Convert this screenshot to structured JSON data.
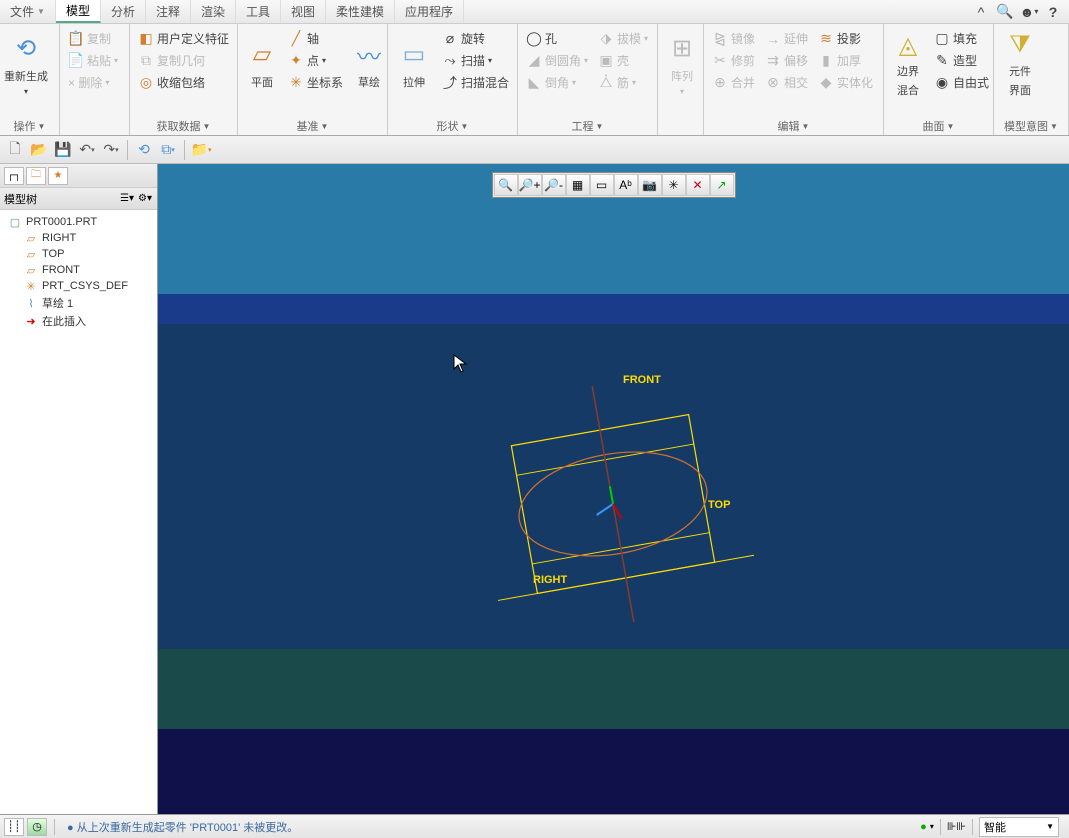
{
  "menu": {
    "file": "文件",
    "model": "模型",
    "analysis": "分析",
    "annotate": "注释",
    "render": "渲染",
    "tools": "工具",
    "view": "视图",
    "flex": "柔性建模",
    "app": "应用程序"
  },
  "ribbon": {
    "ops": {
      "label": "操作",
      "regen": "重新生成",
      "copy": "复制",
      "paste": "粘贴",
      "delete": "× 删除",
      "udf": "用户定义特征",
      "copygeom": "复制几何",
      "shrink": "收缩包络"
    },
    "getdata": {
      "label": "获取数据"
    },
    "datum": {
      "label": "基准",
      "plane": "平面",
      "axis": "轴",
      "point": "点",
      "csys": "坐标系",
      "sketch": "草绘"
    },
    "shape": {
      "label": "形状",
      "extrude": "拉伸",
      "revolve": "旋转",
      "sweep": "扫描",
      "blend": "扫描混合"
    },
    "eng": {
      "label": "工程",
      "hole": "孔",
      "draft": "拔模",
      "chamfer": "倒圆角",
      "edgechamfer": "倒角",
      "shell": "壳",
      "rib": "筋"
    },
    "pattern": {
      "label": "阵列",
      "array": "阵列"
    },
    "edit": {
      "label": "编辑",
      "mirror": "镜像",
      "trim": "修剪",
      "merge": "合并",
      "extend": "延伸",
      "offset": "偏移",
      "intersect": "相交",
      "project": "投影",
      "thicken": "加厚",
      "solidify": "实体化"
    },
    "surf": {
      "label": "曲面",
      "boundary_l1": "边界",
      "boundary_l2": "混合",
      "fill": "填充",
      "style": "造型",
      "freestyle": "自由式"
    },
    "intent": {
      "label": "模型意图",
      "component_l1": "元件",
      "component_l2": "界面"
    }
  },
  "sidebar": {
    "title": "模型树",
    "root": "PRT0001.PRT",
    "items": [
      "RIGHT",
      "TOP",
      "FRONT",
      "PRT_CSYS_DEF",
      "草绘 1",
      "在此插入"
    ]
  },
  "viewport": {
    "front": "FRONT",
    "top": "TOP",
    "right": "RIGHT"
  },
  "status": {
    "msg": "● 从上次重新生成起零件 'PRT0001' 未被更改。",
    "mode": "智能"
  }
}
